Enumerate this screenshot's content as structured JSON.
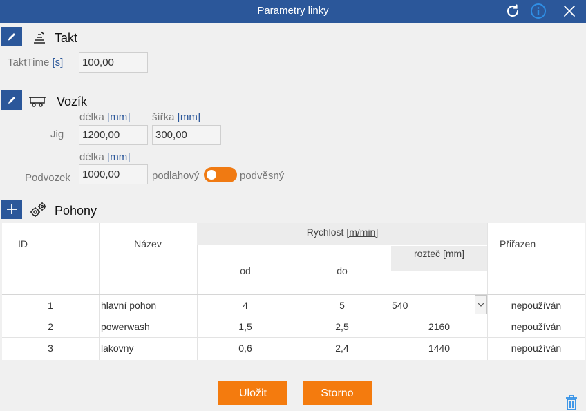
{
  "window": {
    "title": "Parametry linky",
    "icons": [
      "refresh-icon",
      "info-icon",
      "close-icon"
    ],
    "accent_color": "#2b579a",
    "button_color": "#f47b0e"
  },
  "takt": {
    "title": "Takt",
    "field_label": "TaktTime",
    "field_unit": "[s]",
    "value": "100,00"
  },
  "vozik": {
    "title": "Vozík",
    "col_length_label": "délka",
    "col_width_label": "šířka",
    "unit_mm": "[mm]",
    "jig_label": "Jig",
    "jig_length": "1200,00",
    "jig_width": "300,00",
    "podvozek_label": "Podvozek",
    "podvozek_length": "1000,00",
    "toggle_left_label": "podlahový",
    "toggle_right_label": "podvěsný"
  },
  "pohony": {
    "title": "Pohony",
    "headers": {
      "id": "ID",
      "name": "Název",
      "speed": "Rychlost",
      "speed_unit": "[m/min]",
      "from": "od",
      "to": "do",
      "pitch": "rozteč",
      "pitch_unit": "[mm]",
      "assigned": "Přiřazen"
    },
    "rows": [
      {
        "id": "1",
        "name": "hlavní pohon",
        "from": "4",
        "to": "5",
        "pitch": "540",
        "assigned": "nepoužíván"
      },
      {
        "id": "2",
        "name": "powerwash",
        "from": "1,5",
        "to": "2,5",
        "pitch": "2160",
        "assigned": "nepoužíván"
      },
      {
        "id": "3",
        "name": "lakovny",
        "from": "0,6",
        "to": "2,4",
        "pitch": "1440",
        "assigned": "nepoužíván"
      }
    ]
  },
  "footer": {
    "save_label": "Uložit",
    "cancel_label": "Storno"
  }
}
